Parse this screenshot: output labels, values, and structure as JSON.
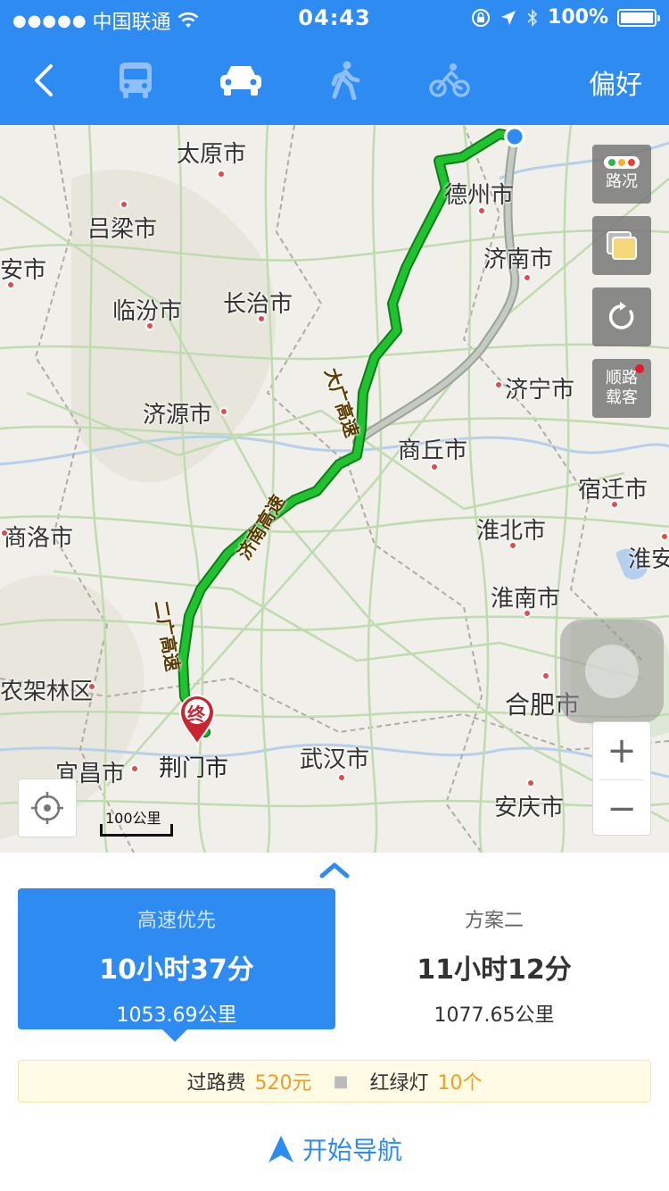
{
  "status_bar": {
    "carrier": "中国联通",
    "time": "04:43",
    "battery": "100%"
  },
  "nav": {
    "preference_label": "偏好",
    "modes": [
      "bus",
      "car",
      "walk",
      "bike"
    ],
    "active_mode": "car"
  },
  "map": {
    "cities": [
      {
        "name": "太原市"
      },
      {
        "name": "吕梁市"
      },
      {
        "name": "安市"
      },
      {
        "name": "临汾市"
      },
      {
        "name": "长治市"
      },
      {
        "name": "德州市"
      },
      {
        "name": "济南市"
      },
      {
        "name": "济宁市"
      },
      {
        "name": "济源市"
      },
      {
        "name": "商丘市"
      },
      {
        "name": "宿迁市"
      },
      {
        "name": "商洛市"
      },
      {
        "name": "淮北市"
      },
      {
        "name": "淮安"
      },
      {
        "name": "淮南市"
      },
      {
        "name": "农架林区"
      },
      {
        "name": "合肥市"
      },
      {
        "name": "宜昌市"
      },
      {
        "name": "荆门市"
      },
      {
        "name": "武汉市"
      },
      {
        "name": "安庆市"
      }
    ],
    "road_labels": [
      "大广高速",
      "济南高速",
      "二广高速"
    ],
    "end_marker": "终",
    "controls": {
      "traffic_label": "路况",
      "ride_share_label_1": "顺路",
      "ride_share_label_2": "载客"
    },
    "scale_label": "100公里"
  },
  "routes": [
    {
      "label": "高速优先",
      "duration": "10小时37分",
      "distance": "1053.69公里",
      "selected": true
    },
    {
      "label": "方案二",
      "duration": "11小时12分",
      "distance": "1077.65公里",
      "selected": false
    }
  ],
  "trip_info": {
    "toll_label": "过路费",
    "toll_value": "520元",
    "lights_label": "红绿灯",
    "lights_value": "10个"
  },
  "start_nav_label": "开始导航",
  "colors": {
    "brand_blue": "#2e8bf2",
    "route_green": "#1cb82e",
    "highlight_orange": "#f39c26"
  }
}
